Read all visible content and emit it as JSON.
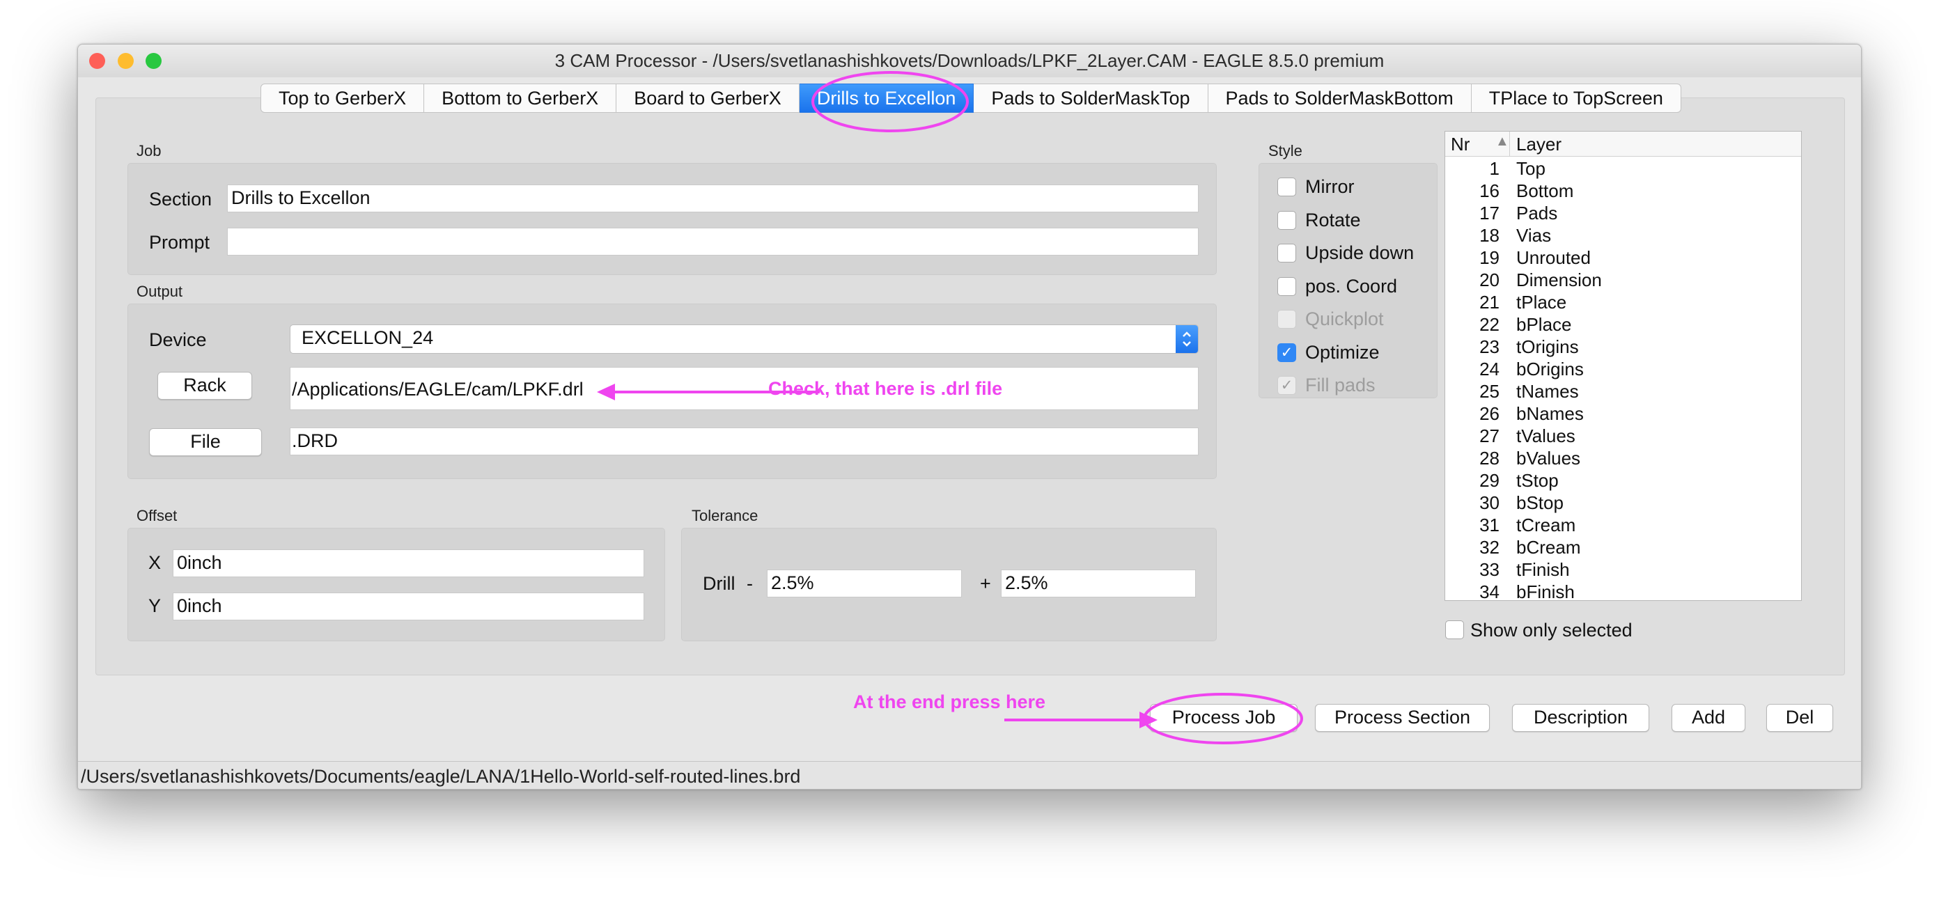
{
  "window": {
    "title": "3 CAM Processor - /Users/svetlanashishkovets/Downloads/LPKF_2Layer.CAM - EAGLE 8.5.0 premium",
    "traffic_lights": {
      "close": "#fe5f57",
      "minimize": "#febc2e",
      "zoom": "#28c840"
    }
  },
  "tabs": [
    {
      "label": "Top to GerberX"
    },
    {
      "label": "Bottom to GerberX"
    },
    {
      "label": "Board to GerberX"
    },
    {
      "label": "Drills to Excellon",
      "active": true
    },
    {
      "label": "Pads to SolderMaskTop"
    },
    {
      "label": "Pads to SolderMaskBottom"
    },
    {
      "label": "TPlace to TopScreen"
    }
  ],
  "job": {
    "group_label": "Job",
    "section_label": "Section",
    "section_value": "Drills to Excellon",
    "prompt_label": "Prompt",
    "prompt_value": ""
  },
  "output": {
    "group_label": "Output",
    "device_label": "Device",
    "device_value": "EXCELLON_24",
    "rack_button": "Rack",
    "rack_value": "/Applications/EAGLE/cam/LPKF.drl",
    "file_button": "File",
    "file_value": ".DRD"
  },
  "offset": {
    "group_label": "Offset",
    "x_label": "X",
    "x_value": "0inch",
    "y_label": "Y",
    "y_value": "0inch"
  },
  "tolerance": {
    "group_label": "Tolerance",
    "drill_label": "Drill",
    "minus_label": "-",
    "minus_value": "2.5%",
    "plus_label": "+",
    "plus_value": "2.5%"
  },
  "style": {
    "group_label": "Style",
    "options": [
      {
        "label": "Mirror",
        "checked": false,
        "disabled": false
      },
      {
        "label": "Rotate",
        "checked": false,
        "disabled": false
      },
      {
        "label": "Upside down",
        "checked": false,
        "disabled": false
      },
      {
        "label": "pos. Coord",
        "checked": false,
        "disabled": false
      },
      {
        "label": "Quickplot",
        "checked": false,
        "disabled": true
      },
      {
        "label": "Optimize",
        "checked": true,
        "disabled": false
      },
      {
        "label": "Fill pads",
        "checked": true,
        "disabled": true
      }
    ]
  },
  "layers": {
    "col_nr": "Nr",
    "sort_glyph": "▲",
    "col_layer": "Layer",
    "rows": [
      {
        "nr": "1",
        "name": "Top"
      },
      {
        "nr": "16",
        "name": "Bottom"
      },
      {
        "nr": "17",
        "name": "Pads"
      },
      {
        "nr": "18",
        "name": "Vias"
      },
      {
        "nr": "19",
        "name": "Unrouted"
      },
      {
        "nr": "20",
        "name": "Dimension"
      },
      {
        "nr": "21",
        "name": "tPlace"
      },
      {
        "nr": "22",
        "name": "bPlace"
      },
      {
        "nr": "23",
        "name": "tOrigins"
      },
      {
        "nr": "24",
        "name": "bOrigins"
      },
      {
        "nr": "25",
        "name": "tNames"
      },
      {
        "nr": "26",
        "name": "bNames"
      },
      {
        "nr": "27",
        "name": "tValues"
      },
      {
        "nr": "28",
        "name": "bValues"
      },
      {
        "nr": "29",
        "name": "tStop"
      },
      {
        "nr": "30",
        "name": "bStop"
      },
      {
        "nr": "31",
        "name": "tCream"
      },
      {
        "nr": "32",
        "name": "bCream"
      },
      {
        "nr": "33",
        "name": "tFinish"
      },
      {
        "nr": "34",
        "name": "bFinish"
      }
    ],
    "show_only_selected_label": "Show only selected",
    "show_only_selected_checked": false
  },
  "buttons": {
    "process_job": "Process Job",
    "process_section": "Process Section",
    "description": "Description",
    "add": "Add",
    "del": "Del"
  },
  "status_bar": {
    "path": "/Users/svetlanashishkovets/Documents/eagle/LANA/1Hello-World-self-routed-lines.brd"
  },
  "annotations": {
    "color": "#ef45ef",
    "rack_note": "Check, that here is .drl file",
    "process_note": "At the end press here"
  }
}
